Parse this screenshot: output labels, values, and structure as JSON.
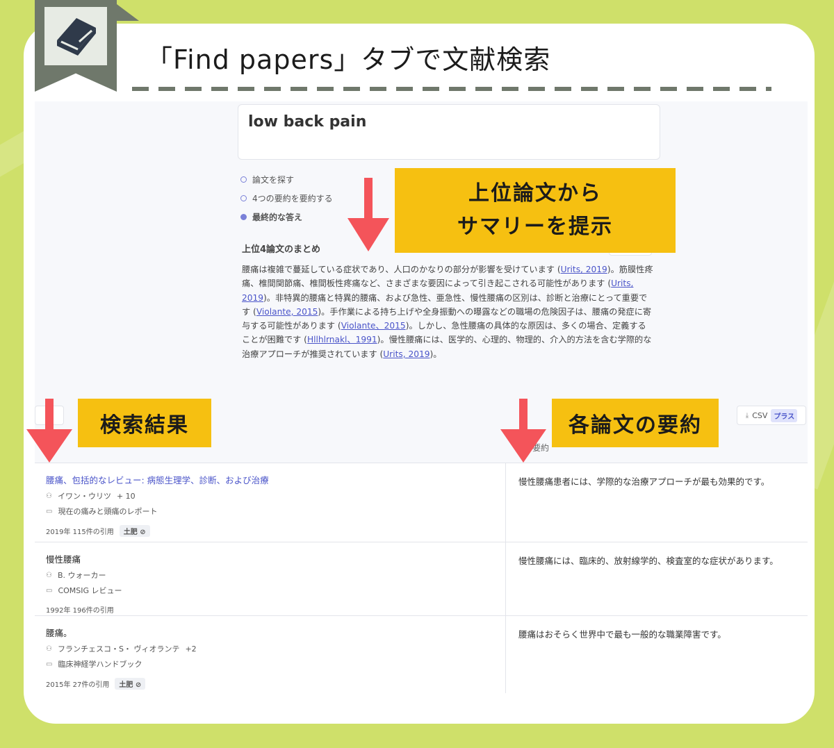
{
  "page": {
    "title": "「Find papers」タブで文献検索"
  },
  "query": {
    "text": "low back pain"
  },
  "steps": [
    {
      "label": "論文を探す",
      "state": "done"
    },
    {
      "label": "4つの要約を要約する",
      "state": "done"
    },
    {
      "label": "最終的な答え",
      "state": "active"
    }
  ],
  "summary": {
    "title": "上位4論文のまとめ",
    "s1": "腰痛は複雑で蔓延している症状であり、人口のかなりの部分が影響を受けています (",
    "c1": "Urits, 2019",
    "s2": ")。筋膜性疼痛、椎間関節痛、椎間板性疼痛など、さまざまな要因によって引き起こされる可能性があります (",
    "c2": "Urits, 2019",
    "s3": ")。非特異的腰痛と特異的腰痛、および急性、亜急性、慢性腰痛の区別は、診断と治療にとって重要です (",
    "c3": "Violante, 2015",
    "s4": ")。手作業による持ち上げや全身振動への曝露などの職場の危険因子は、腰痛の発症に寄与する可能性があります (",
    "c4": "Violante、2015",
    "s5": ")。しかし、急性腰痛の具体的な原因は、多くの場合、定義することが困難です (",
    "c5": "Hllhlrnakl、1991",
    "s6": ")。慢性腰痛には、医学的、心理的、物理的、介入的方法を含む学際的な治療アプローチが推奨されています (",
    "c6": "Urits, 2019",
    "s7": ")。"
  },
  "controls": {
    "filter_label": "選",
    "csv_label": "CSV",
    "plus_badge": "プラス",
    "column_header": "要約"
  },
  "papers": [
    {
      "title": "腰痛、包括的なレビュー: 病態生理学、診断、および治療",
      "authors": "イワン・ウリツ",
      "authors_extra": "+ 10",
      "journal": "現在の痛みと頭痛のレポート",
      "year_citations": "2019年 115件の引用",
      "tag": "土肥",
      "summary": "慢性腰痛患者には、学際的な治療アプローチが最も効果的です。"
    },
    {
      "title": "慢性腰痛",
      "authors": "B. ウォーカー",
      "authors_extra": "",
      "journal": "COMSIG レビュー",
      "year_citations": "1992年 196件の引用",
      "tag": "",
      "summary": "慢性腰痛には、臨床的、放射線学的、検査室的な症状があります。"
    },
    {
      "title": "腰痛。",
      "authors": "フランチェスコ・S・ ヴィオランテ",
      "authors_extra": "+2",
      "journal": "臨床神経学ハンドブック",
      "year_citations": "2015年 27件の引用",
      "tag": "土肥",
      "summary": "腰痛はおそらく世界中で最も一般的な職業障害です。"
    }
  ],
  "callouts": {
    "top_line1": "上位論文から",
    "top_line2": "サマリーを提示",
    "results": "検索結果",
    "each_summary": "各論文の要約"
  },
  "colors": {
    "background": "#cfe06a",
    "callout": "#f6c011",
    "arrow": "#f4545a",
    "accent": "#4a54c9",
    "bookmark": "#6f786b"
  }
}
